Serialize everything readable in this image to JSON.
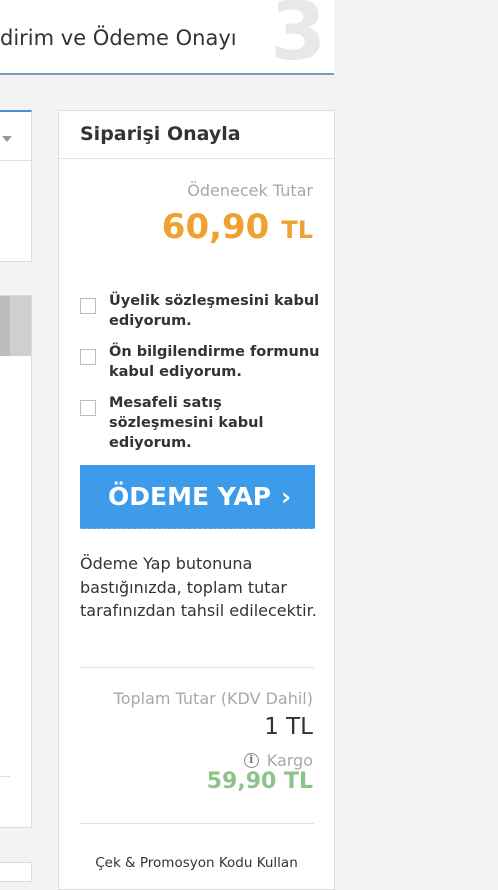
{
  "step": {
    "title": "dirim ve Ödeme Onayı",
    "number": "3"
  },
  "order": {
    "title": "Siparişi Onayla",
    "payable_label": "Ödenecek Tutar",
    "payable_amount": "60,90",
    "currency": "TL",
    "payable_color": "#f0a030",
    "agreements": [
      {
        "label": "Üyelik sözleşmesini kabul ediyorum.",
        "checked": false
      },
      {
        "label": "Ön bilgilendirme formunu kabul ediyorum.",
        "checked": false
      },
      {
        "label": "Mesafeli satış sözleşmesini kabul ediyorum.",
        "checked": false
      }
    ],
    "pay_button": {
      "label": "ÖDEME YAP",
      "arrow": "›",
      "color": "#3d9be9"
    },
    "pay_info": "Ödeme Yap butonuna bastığınızda, toplam tutar tarafınızdan tahsil edilecektir.",
    "total_label": "Toplam Tutar (KDV Dahil)",
    "total_value": "1 TL",
    "cargo_label": "Kargo",
    "cargo_icon": "info-icon",
    "cargo_value": "59,90 TL",
    "cargo_color": "#8dc28a",
    "promo_link": "Çek & Promosyon Kodu Kullan"
  }
}
